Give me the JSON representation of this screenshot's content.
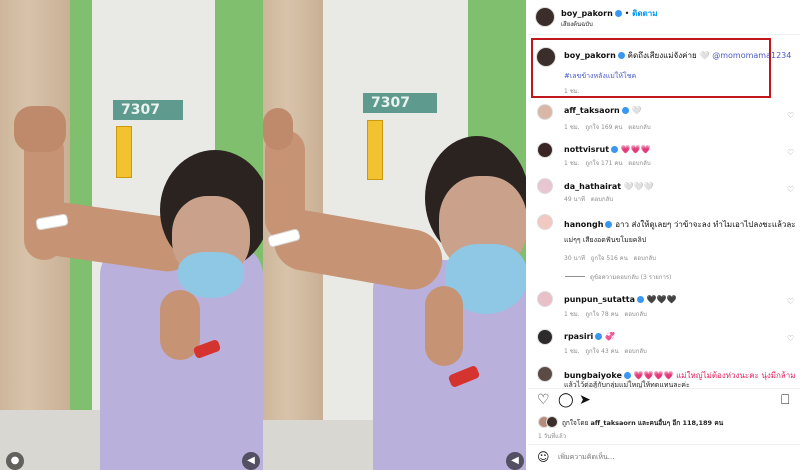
{
  "post": {
    "username": "boy_pakorn",
    "follow_label": "ติดตาม",
    "dot": "•",
    "subtitle": "เสียงต้นฉบับ",
    "caption_text": "คิดถึงเสียงแม่จังค่าย",
    "caption_mention": "@momomama1234",
    "caption_hashtag": "#เลขข้างหลังแม่ให้โชค",
    "caption_time": "1 ชม."
  },
  "comments": [
    {
      "user": "aff_taksaorn",
      "verified": true,
      "text": "🤍",
      "meta_time": "1 ชม.",
      "likes": "ถูกใจ 169 คน",
      "reply": "ตอบกลับ"
    },
    {
      "user": "nottvisrut",
      "verified": true,
      "text": "💗💗💗",
      "meta_time": "1 ชม.",
      "likes": "ถูกใจ 171 คน",
      "reply": "ตอบกลับ"
    },
    {
      "user": "da_hathairat",
      "verified": false,
      "text": "🤍🤍🤍",
      "meta_time": "49 นาที",
      "likes": "",
      "reply": "ตอบกลับ"
    },
    {
      "user": "hanongh",
      "verified": true,
      "text": "อาว ส่งให้ดูเลยๆ ว่าข้าจะลง ทำไมเอาไปลงชะแล้วละ",
      "text2": "แม่ๆๆ เสียงอดฟันขโมยคลิป",
      "meta_time": "30 นาที",
      "likes": "ถูกใจ 516 คน",
      "reply": "ตอบกลับ",
      "view_replies": "ดูข้อความตอบกลับ (3 รายการ)"
    },
    {
      "user": "punpun_sutatta",
      "verified": true,
      "text": "🖤🖤🖤",
      "meta_time": "1 ชม.",
      "likes": "ถูกใจ 78 คน",
      "reply": "ตอบกลับ"
    },
    {
      "user": "rpasiri",
      "verified": true,
      "text": "💞",
      "meta_time": "1 ชม.",
      "likes": "ถูกใจ 43 คน",
      "reply": "ตอบกลับ"
    },
    {
      "user": "bungbaiyoke",
      "verified": true,
      "text": "💗💗💗💗 แม่ใหญ่ไม่ต้องห่วงนะคะ นุ่งมีกล้าม",
      "text2": "แล้วไว้ต่อสู้กับกลุ่มแม่ใหญ่ให้ทดแทนละค่ะ"
    }
  ],
  "likes_line": {
    "prefix": "ถูกใจโดย",
    "user": "aff_taksaorn",
    "suffix": "และคนอื่นๆ อีก 118,189 คน"
  },
  "post_time": "1 วันที่แล้ว",
  "add_comment_placeholder": "เพิ่มความคิดเห็น...",
  "room_sign": "7307",
  "icons": [
    "heart-icon",
    "comment-icon",
    "share-icon",
    "bookmark-icon",
    "emoji-icon",
    "volume-icon",
    "person-icon"
  ]
}
